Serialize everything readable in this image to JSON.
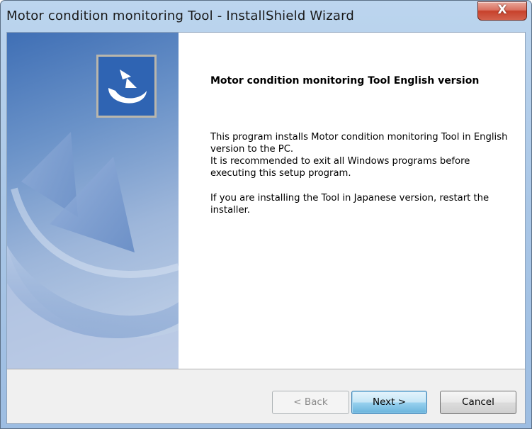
{
  "window": {
    "title": "Motor condition monitoring Tool - InstallShield Wizard",
    "close_label": "X"
  },
  "welcome": {
    "heading": "Motor condition monitoring Tool English version",
    "paragraph1_line1": "This program installs Motor condition monitoring Tool in English version to the PC.",
    "paragraph1_line2": "It is recommended to exit all Windows programs before executing this setup program.",
    "paragraph2": "If you are installing the Tool in Japanese version, restart the installer."
  },
  "buttons": {
    "back": "< Back",
    "next": "Next >",
    "cancel": "Cancel"
  }
}
